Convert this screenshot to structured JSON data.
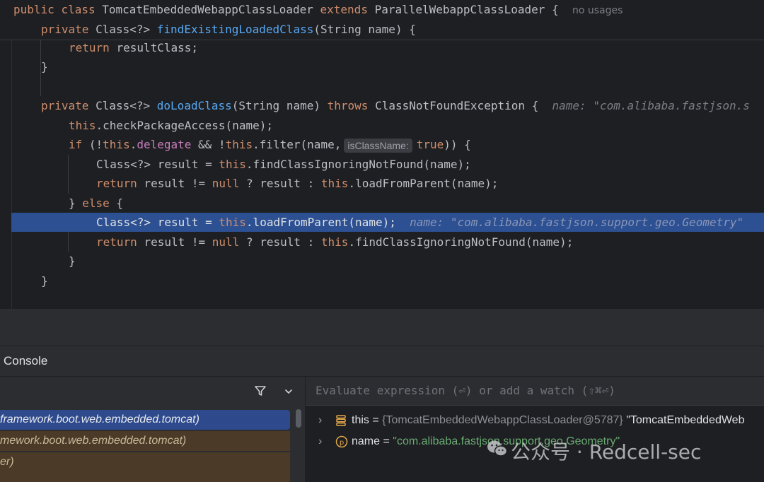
{
  "editor": {
    "sticky_1": {
      "kw_public": "public",
      "kw_class": "class",
      "class_name": "TomcatEmbeddedWebappClassLoader",
      "kw_extends": "extends",
      "super_name": "ParallelWebappClassLoader",
      "brace": "{",
      "usages": "no usages"
    },
    "sticky_2": {
      "kw_private": "private",
      "ret_type": "Class<?>",
      "method": "findExistingLoadedClass",
      "params": "(String name) {"
    },
    "line_return_result": {
      "kw_return": "return",
      "rest": "resultClass;"
    },
    "close_brace": "}",
    "doload": {
      "kw_private": "private",
      "ret_type": "Class<?>",
      "method": "doLoadClass",
      "params": "(String name)",
      "kw_throws": "throws",
      "exception": "ClassNotFoundException {",
      "hint": "name: \"com.alibaba.fastjson.s"
    },
    "check": {
      "kw_this": "this",
      "rest": ".checkPackageAccess(name);"
    },
    "if_line": {
      "kw_if": "if",
      "p1": "(!",
      "kw_this1": "this",
      "dot": ".",
      "field": "delegate",
      "p2": " && !",
      "kw_this2": "this",
      "p3": ".filter(name,",
      "chip": "isClassName:",
      "kw_true": "true",
      "p4": ")) {"
    },
    "result1": {
      "type": "Class<?> result = ",
      "kw_this": "this",
      "rest": ".findClassIgnoringNotFound(name);"
    },
    "return1": {
      "kw_return": "return",
      "p1": "result != ",
      "kw_null": "null",
      "p2": "? result : ",
      "kw_this": "this",
      "rest": ".loadFromParent(name);"
    },
    "else_line": {
      "p1": "} ",
      "kw_else": "else",
      "p2": " {"
    },
    "result2": {
      "type": "Class<?> result = ",
      "kw_this": "this",
      "rest": ".loadFromParent(name);",
      "hint": "name: \"com.alibaba.fastjson.support.geo.Geometry\""
    },
    "return2": {
      "kw_return": "return",
      "p1": "result != ",
      "kw_null": "null",
      "p2": "? result : ",
      "kw_this": "this",
      "rest": ".findClassIgnoringNotFound(name);"
    }
  },
  "console": {
    "tab_label": "Console"
  },
  "frames": {
    "items": [
      "framework.boot.web.embedded.tomcat)",
      "mework.boot.web.embedded.tomcat)",
      "er)"
    ]
  },
  "variables": {
    "eval_placeholder": "Evaluate expression (⏎) or add a watch (⇧⌘⏎)",
    "items": [
      {
        "name": "this",
        "eq": " = ",
        "type": "{TomcatEmbeddedWebappClassLoader@5787}",
        "value": " \"TomcatEmbeddedWeb",
        "icon": "field-list-icon"
      },
      {
        "name": "name",
        "eq": " = ",
        "value": "\"com.alibaba.fastjson.support.geo.Geometry\"",
        "icon": "parameter-icon"
      }
    ]
  },
  "watermark": {
    "text": "公众号 · Redcell-sec"
  },
  "colors": {
    "background": "#1e1f22",
    "keyword": "#cf8e6d",
    "method": "#56a8f5",
    "field": "#c77dbb",
    "string": "#6aab73",
    "selection": "#2d5092"
  }
}
